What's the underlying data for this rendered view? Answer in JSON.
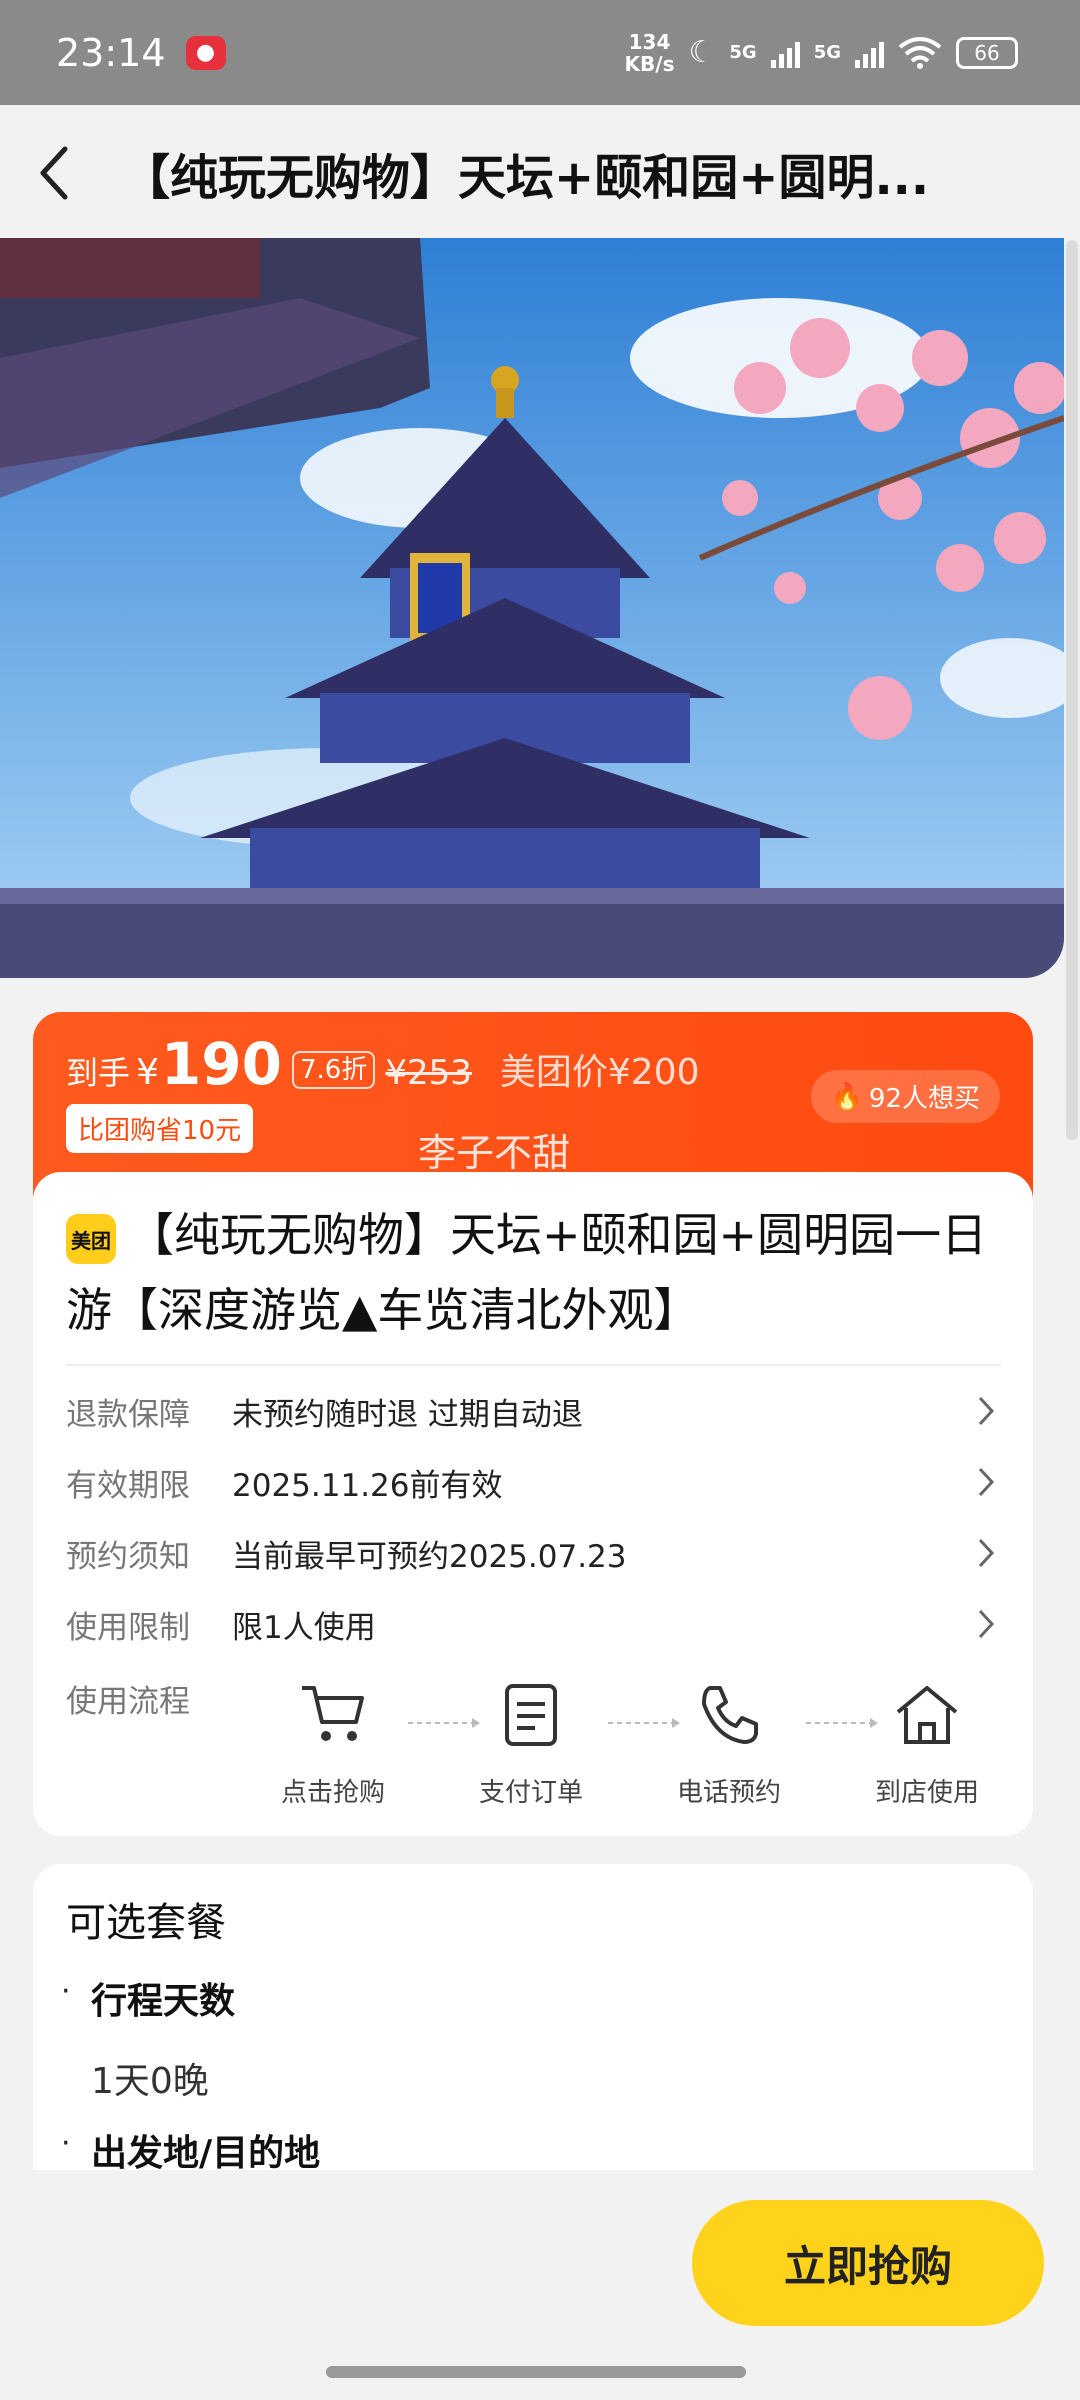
{
  "status_bar": {
    "time": "23:14",
    "net_speed_value": "134",
    "net_speed_unit": "KB/s",
    "net1": "5G",
    "net2": "5G",
    "battery": "66"
  },
  "header": {
    "title": "【纯玩无购物】天坛+颐和园+圆明..."
  },
  "price": {
    "prefix": "到手",
    "currency": "¥",
    "value": "190",
    "discount": "7.6折",
    "original": "¥253",
    "meituan_price": "美团价¥200",
    "saving": "比团购省10元",
    "want_count": "92人想买",
    "watermark": "李子不甜"
  },
  "product": {
    "logo_text": "美团",
    "title": "【纯玩无购物】天坛+颐和园+圆明园一日游【深度游览▲车览清北外观】"
  },
  "info_rows": [
    {
      "label": "退款保障",
      "value": "未预约随时退 过期自动退"
    },
    {
      "label": "有效期限",
      "value": "2025.11.26前有效"
    },
    {
      "label": "预约须知",
      "value": "当前最早可预约2025.07.23"
    },
    {
      "label": "使用限制",
      "value": "限1人使用"
    }
  ],
  "flow": {
    "label": "使用流程",
    "steps": [
      {
        "icon": "cart-icon",
        "label": "点击抢购"
      },
      {
        "icon": "order-icon",
        "label": "支付订单"
      },
      {
        "icon": "phone-icon",
        "label": "电话预约"
      },
      {
        "icon": "home-icon",
        "label": "到店使用"
      }
    ]
  },
  "packages": {
    "title": "可选套餐",
    "items": [
      {
        "name": "行程天数",
        "value": "1天0晚"
      },
      {
        "name": "出发地/目的地",
        "value": ""
      }
    ]
  },
  "bottom": {
    "buy_label": "立即抢购"
  },
  "colors": {
    "accent_orange": "#ff4a10",
    "buy_yellow": "#ffd21c",
    "meituan_yellow": "#ffcd1a"
  }
}
